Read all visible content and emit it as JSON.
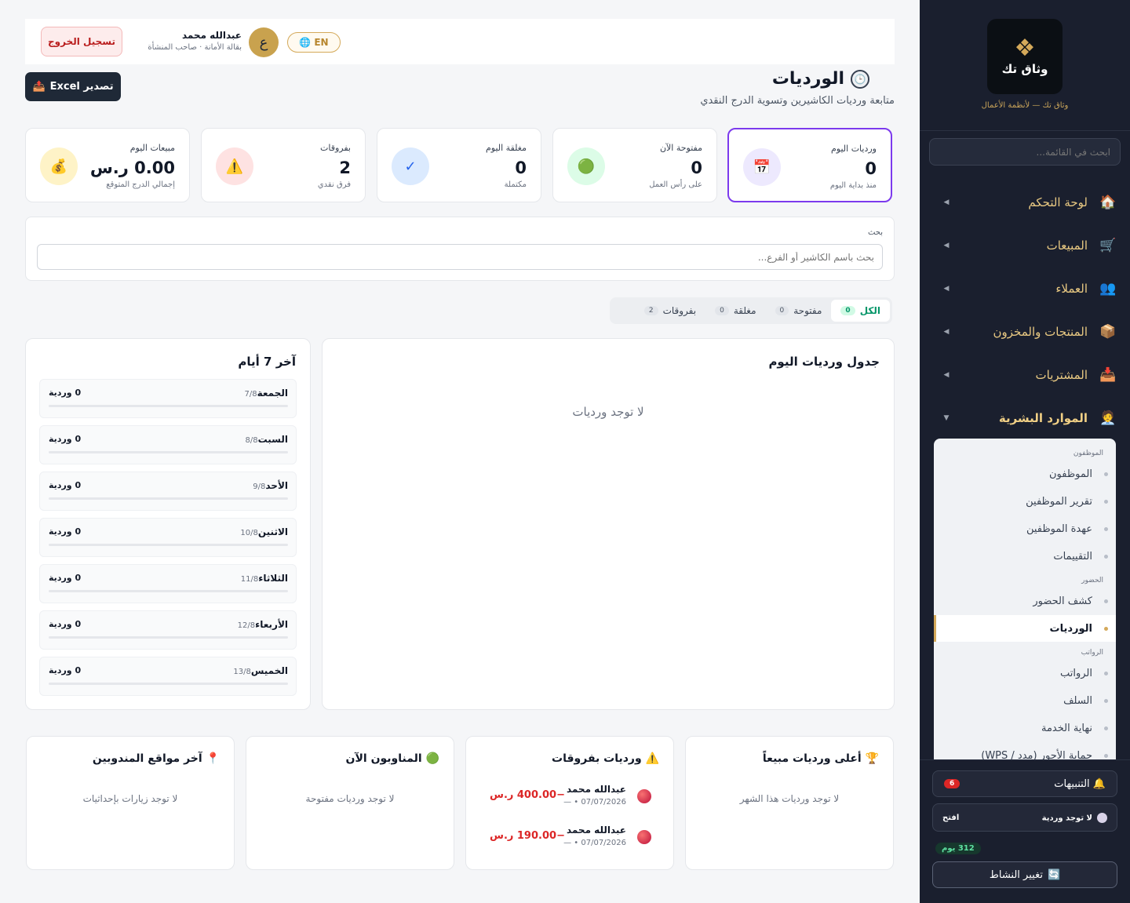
{
  "sidebar": {
    "logo_name": "وثاق تك",
    "tagline": "وثاق تك — لأنظمة الأعمال",
    "search_placeholder": "ابحث في القائمة...",
    "nav": [
      {
        "label": "لوحة التحكم",
        "icon": "🏠"
      },
      {
        "label": "المبيعات",
        "icon": "🛒"
      },
      {
        "label": "العملاء",
        "icon": "👥"
      },
      {
        "label": "المنتجات والمخزون",
        "icon": "📦"
      },
      {
        "label": "المشتريات",
        "icon": "📥"
      },
      {
        "label": "الموارد البشرية",
        "icon": "🧑‍💼"
      }
    ],
    "submenu": {
      "group_employees": "الموظفون",
      "employees": "الموظفون",
      "employees_report": "تقرير الموظفين",
      "employees_custody": "عهدة الموظفين",
      "evaluations": "التقييمات",
      "group_attendance": "الحضور",
      "attendance_sheet": "كشف الحضور",
      "shifts": "الورديات",
      "group_payroll": "الرواتب",
      "payroll": "الرواتب",
      "advances": "السلف",
      "end_of_service": "نهاية الخدمة",
      "wps": "حماية الأجور (مدد / WPS)"
    },
    "alerts_label": "التنبيهات",
    "alerts_count": "6",
    "shift_status": "لا توجد وردية",
    "shift_open": "افتح",
    "days_left": "312 يوم",
    "change_activity": "تغيير النشاط"
  },
  "topbar": {
    "logout": "تسجيل الخروج",
    "user_name": "عبدالله محمد",
    "user_sub": "بقالة الأمانة · صاحب المنشأة",
    "avatar_letter": "ع",
    "lang": "EN"
  },
  "page": {
    "title": "الورديات",
    "subtitle": "متابعة ورديات الكاشيرين وتسوية الدرج النقدي",
    "export": "تصدير Excel"
  },
  "stats": [
    {
      "label": "ورديات اليوم",
      "value": "0",
      "sub": "منذ بداية اليوم",
      "icon": "📅",
      "color": "#ede9fe"
    },
    {
      "label": "مفتوحة الآن",
      "value": "0",
      "sub": "على رأس العمل",
      "icon": "🟢",
      "color": "#dcfce7"
    },
    {
      "label": "مغلقة اليوم",
      "value": "0",
      "sub": "مكتملة",
      "icon": "✓",
      "color": "#dbeafe"
    },
    {
      "label": "بفروقات",
      "value": "2",
      "sub": "فرق نقدي",
      "icon": "⚠️",
      "color": "#fee2e2"
    },
    {
      "label": "مبيعات اليوم",
      "value": "0.00 ر.س",
      "sub": "إجمالي الدرج المتوقع",
      "icon": "💰",
      "color": "#fef3c7"
    }
  ],
  "search": {
    "label": "بحث",
    "placeholder": "بحث باسم الكاشير أو الفرع..."
  },
  "tabs": [
    {
      "label": "الكل",
      "count": "0"
    },
    {
      "label": "مفتوحة",
      "count": "0"
    },
    {
      "label": "مغلقة",
      "count": "0"
    },
    {
      "label": "بفروقات",
      "count": "2"
    }
  ],
  "schedule": {
    "title": "جدول ورديات اليوم",
    "empty": "لا توجد ورديات"
  },
  "last7": {
    "title": "آخر 7 أيام",
    "days": [
      {
        "name": "الجمعة",
        "date": "7/8",
        "count": "0 وردية"
      },
      {
        "name": "السبت",
        "date": "8/8",
        "count": "0 وردية"
      },
      {
        "name": "الأحد",
        "date": "9/8",
        "count": "0 وردية"
      },
      {
        "name": "الاثنين",
        "date": "10/8",
        "count": "0 وردية"
      },
      {
        "name": "الثلاثاء",
        "date": "11/8",
        "count": "0 وردية"
      },
      {
        "name": "الأربعاء",
        "date": "12/8",
        "count": "0 وردية"
      },
      {
        "name": "الخميس",
        "date": "13/8",
        "count": "0 وردية"
      }
    ]
  },
  "bottom": {
    "top_sales": {
      "title": "أعلى ورديات مبيعاً",
      "icon": "🏆",
      "empty": "لا توجد ورديات هذا الشهر"
    },
    "diffs": {
      "title": "ورديات بفروقات",
      "icon": "⚠️",
      "rows": [
        {
          "name": "عبدالله محمد",
          "date": "07/07/2026 • —",
          "amount": "−400.00 ر.س"
        },
        {
          "name": "عبدالله محمد",
          "date": "07/07/2026 • —",
          "amount": "−190.00 ر.س"
        }
      ]
    },
    "on_duty": {
      "title": "المناوبون الآن",
      "icon": "🟢",
      "empty": "لا توجد ورديات مفتوحة"
    },
    "reps": {
      "title": "آخر مواقع المندوبين",
      "icon": "📍",
      "empty": "لا توجد زيارات بإحداثيات"
    }
  }
}
